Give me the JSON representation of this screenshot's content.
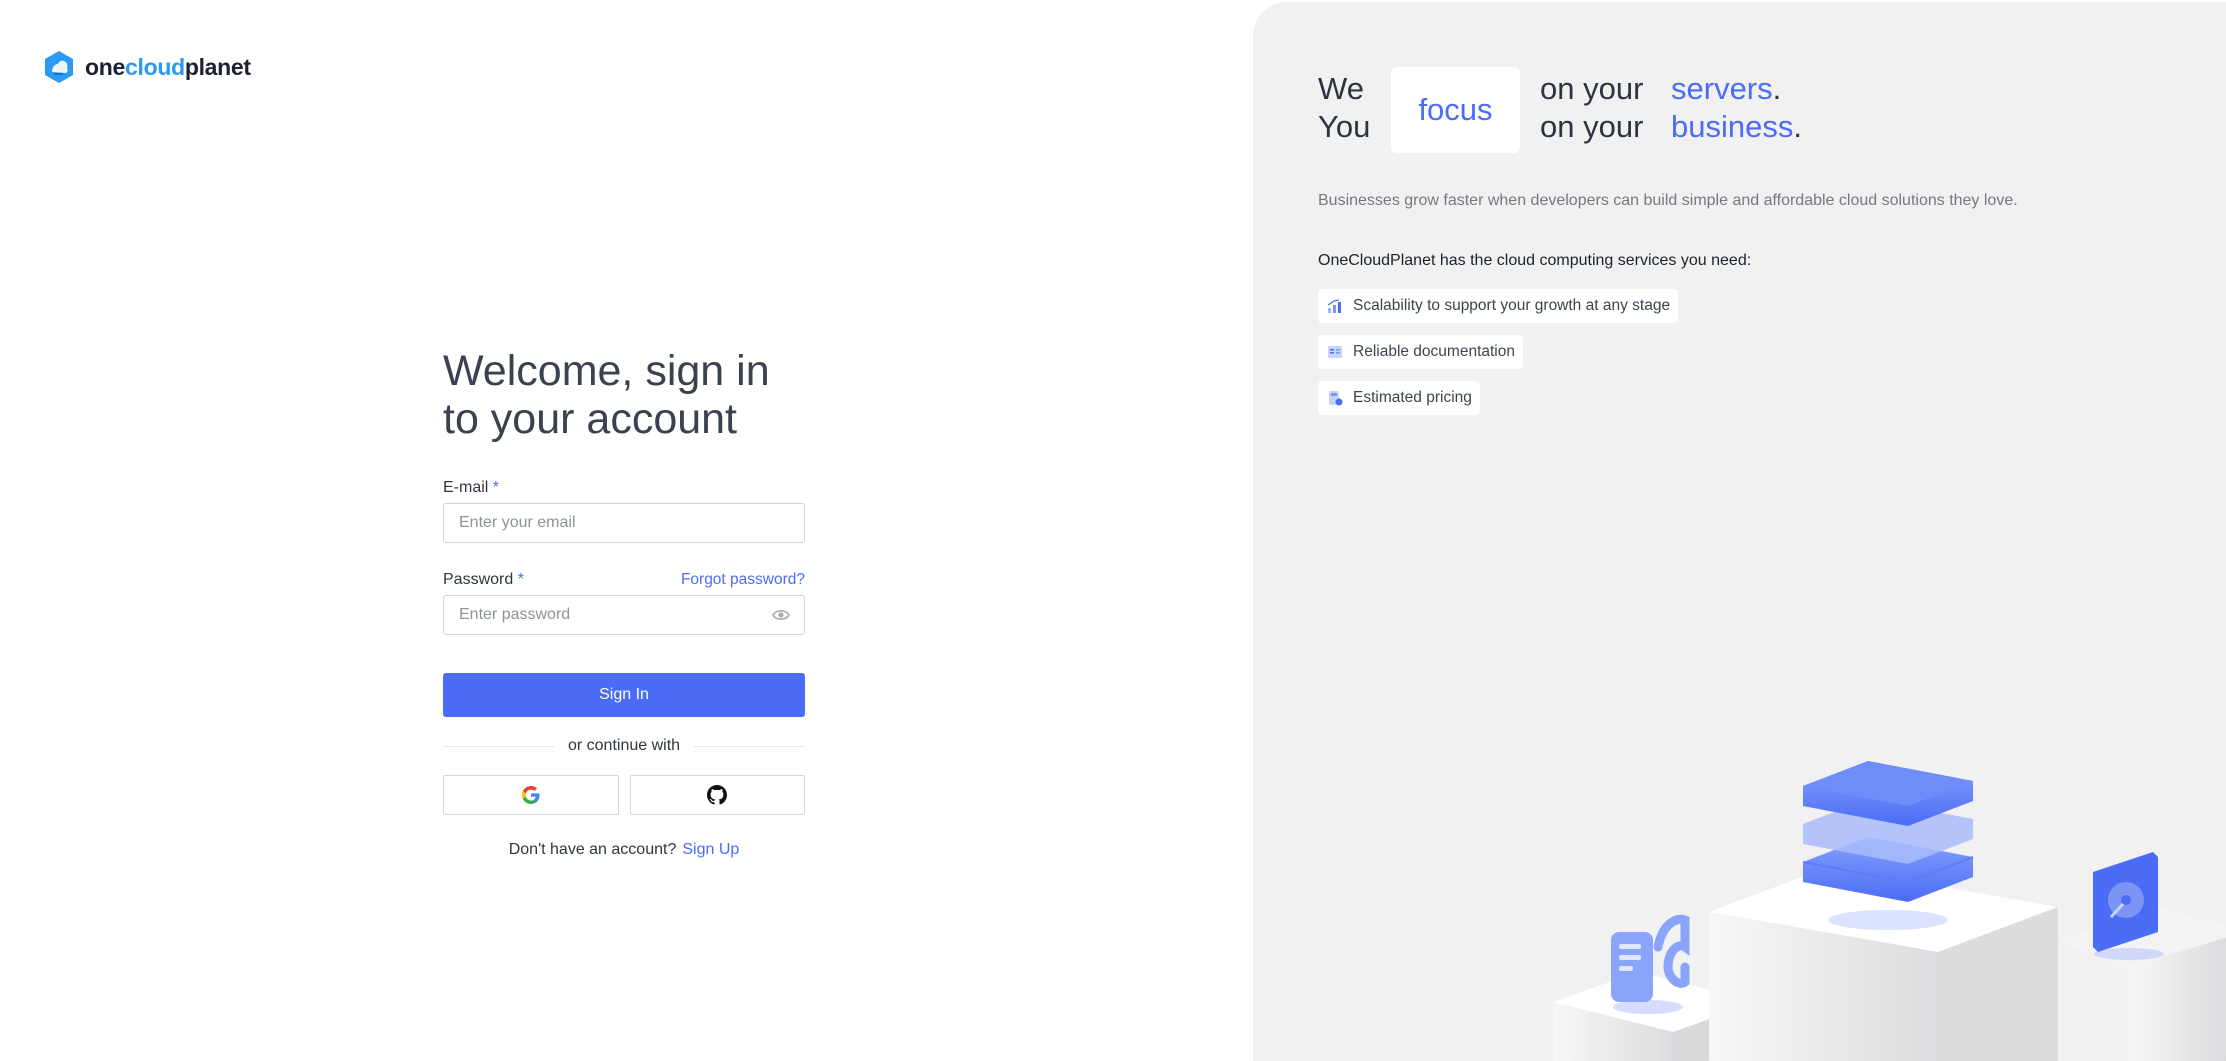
{
  "brand": {
    "part1": "one",
    "part2": "cloud",
    "part3": "planet"
  },
  "login": {
    "title_line1": "Welcome, sign in",
    "title_line2": "to your account",
    "email_label": "E-mail",
    "email_placeholder": "Enter your email",
    "password_label": "Password",
    "password_placeholder": "Enter password",
    "required_mark": "*",
    "forgot_label": "Forgot password?",
    "signin_label": "Sign In",
    "divider_label": "or continue with",
    "no_account_text": "Don't have an account?",
    "signup_label": "Sign Up",
    "social": [
      "google-icon",
      "github-icon"
    ]
  },
  "panel": {
    "we": "We",
    "you": "You",
    "focus": "focus",
    "on_your_1": "on your",
    "on_your_2": "on your",
    "servers": "servers",
    "business": "business",
    "period": ".",
    "subtext": "Businesses grow faster when developers can build simple and affordable cloud solutions they love.",
    "needs": "OneCloudPlanet has the cloud computing services you need:",
    "features": [
      {
        "label": "Scalability to support your growth at any stage",
        "icon": "chart-icon"
      },
      {
        "label": "Reliable documentation",
        "icon": "document-icon"
      },
      {
        "label": "Estimated pricing",
        "icon": "calculator-icon"
      }
    ]
  },
  "colors": {
    "accent": "#4a6cf7",
    "brand_blue": "#2b9af3",
    "panel_bg": "#f2f1f2"
  }
}
